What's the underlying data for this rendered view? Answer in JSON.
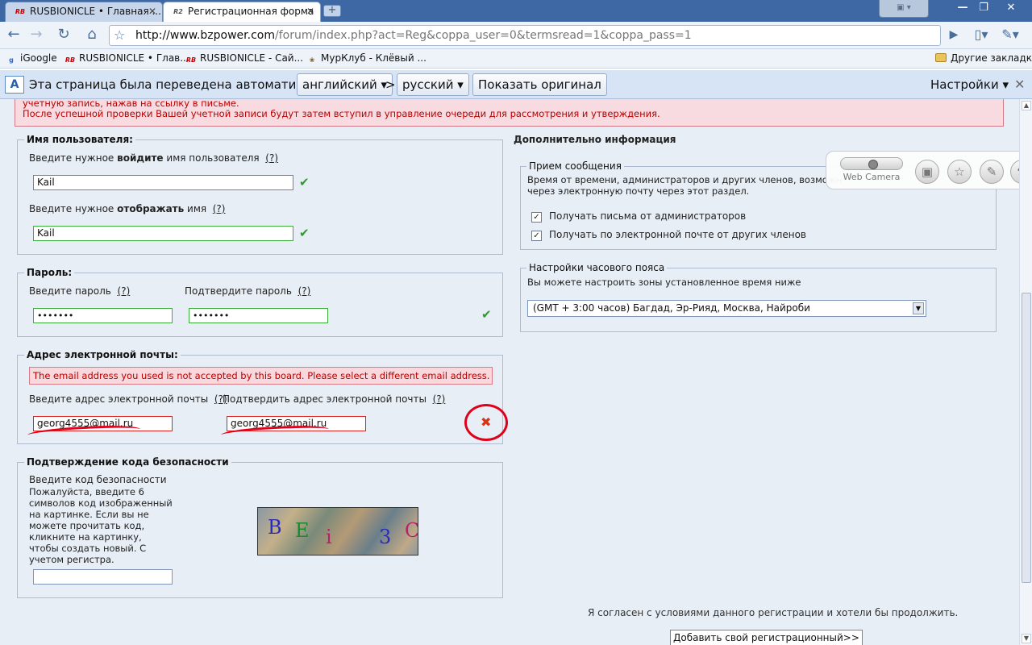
{
  "browser": {
    "tabs": [
      {
        "favicon": "RB",
        "title": "RUSBIONICLE • Главная ..."
      },
      {
        "favicon": "R2",
        "title": "Регистрационная форма"
      }
    ],
    "window_controls": {
      "minimize": "—",
      "restore": "❐",
      "close": "✕"
    },
    "camera_widget": "▣ ▾",
    "url_host": "http://www.bzpower.com",
    "url_path": "/forum/index.php?act=Reg&coppa_user=0&termsread=1&coppa_pass=1",
    "bookmarks": [
      {
        "label": "iGoogle"
      },
      {
        "label": "RUSBIONICLE • Глав..."
      },
      {
        "label": "RUSBIONICLE - Сай..."
      },
      {
        "label": "МурКлуб - Клёвый ..."
      }
    ],
    "other_bookmarks": "Другие закладки"
  },
  "translate_bar": {
    "message": "Эта страница была переведена автоматически",
    "from_lang": "английский ▾",
    "arrow": ">",
    "to_lang": "русский ▾",
    "show_original": "Показать оригинал",
    "settings": "Настройки ▾",
    "close": "✕"
  },
  "error_banner": {
    "line1": "учетную запись, нажав на ссылку в письме.",
    "line2": "После успешной проверки Вашей учетной записи будут затем вступил в управление очереди для рассмотрения и утверждения."
  },
  "username": {
    "legend": "Имя пользователя:",
    "login_prefix": "Введите нужное ",
    "login_bold": "войдите",
    "login_suffix": " имя пользователя",
    "help": "(?)",
    "login_value": "Kail",
    "display_prefix": "Введите нужное ",
    "display_bold": "отображать",
    "display_suffix": " имя",
    "display_value": "Kail",
    "check": "✔"
  },
  "password": {
    "legend": "Пароль:",
    "enter_label": "Введите пароль",
    "confirm_label": "Подтвердите пароль",
    "help": "(?)",
    "value": "•••••••",
    "confirm_value": "•••••••",
    "check": "✔"
  },
  "email": {
    "legend": "Адрес электронной почты:",
    "error": "The email address you used is not accepted by this board. Please select a different email address.",
    "enter_label": "Введите адрес электронной почты",
    "confirm_label": "Подтвердить адрес электронной почты",
    "help": "(?)",
    "value": "georg4555@mail.ru",
    "confirm_value": "georg4555@mail.ru",
    "x": "✖"
  },
  "captcha": {
    "legend": "Подтверждение кода безопасности",
    "label": "Введите код безопасности",
    "instructions": "Пожалуйста, введите 6 символов код изображенный на картинке. Если вы не можете прочитать код, кликните на картинку, чтобы создать новый. С учетом регистра.",
    "image_chars": [
      "B",
      "E",
      "i",
      "3",
      "C"
    ],
    "input_value": ""
  },
  "extra": {
    "heading": "Дополнительно информация",
    "messages_legend": "Прием сообщения",
    "messages_desc1": "Время от времени, администраторов и других членов, возможн",
    "messages_desc2": "через электронную почту через этот раздел.",
    "opt_admin": "Получать письма от администраторов",
    "opt_members": "Получать по электронной почте от других членов",
    "checkmark": "✓",
    "tz_legend": "Настройки часового пояса",
    "tz_desc": "Вы можете настроить зоны установленное время ниже",
    "tz_value": "(GMT + 3:00 часов) Багдад, Эр-Рияд, Москва, Найроби"
  },
  "webcam": {
    "label": "Web Camera"
  },
  "footer": {
    "agree": "Я согласен с условиями данного регистрации и хотели бы продолжить.",
    "submit": "Добавить свой регистрационный>>"
  },
  "colors": {
    "error_red": "#b00000",
    "valid_green": "#2f9a2f",
    "annotation_red": "#e0001a",
    "chrome_blue": "#3e68a4"
  }
}
